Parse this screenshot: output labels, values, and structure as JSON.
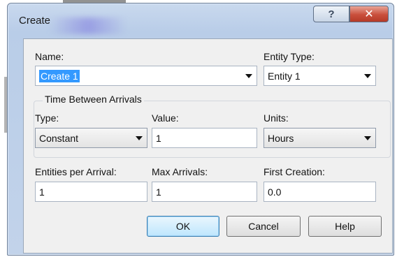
{
  "window": {
    "title": "Create"
  },
  "titlebar": {
    "help_glyph": "?",
    "close_glyph": "✕"
  },
  "form": {
    "name": {
      "label": "Name:",
      "value": "Create 1"
    },
    "entity_type": {
      "label": "Entity Type:",
      "value": "Entity 1"
    },
    "time_between_arrivals": {
      "group_label": "Time Between Arrivals",
      "type": {
        "label": "Type:",
        "value": "Constant"
      },
      "value": {
        "label": "Value:",
        "value": "1"
      },
      "units": {
        "label": "Units:",
        "value": "Hours"
      }
    },
    "entities_per_arrival": {
      "label": "Entities per Arrival:",
      "value": "1"
    },
    "max_arrivals": {
      "label": "Max Arrivals:",
      "value": "1"
    },
    "first_creation": {
      "label": "First Creation:",
      "value": "0.0"
    }
  },
  "buttons": {
    "ok": "OK",
    "cancel": "Cancel",
    "help": "Help"
  }
}
